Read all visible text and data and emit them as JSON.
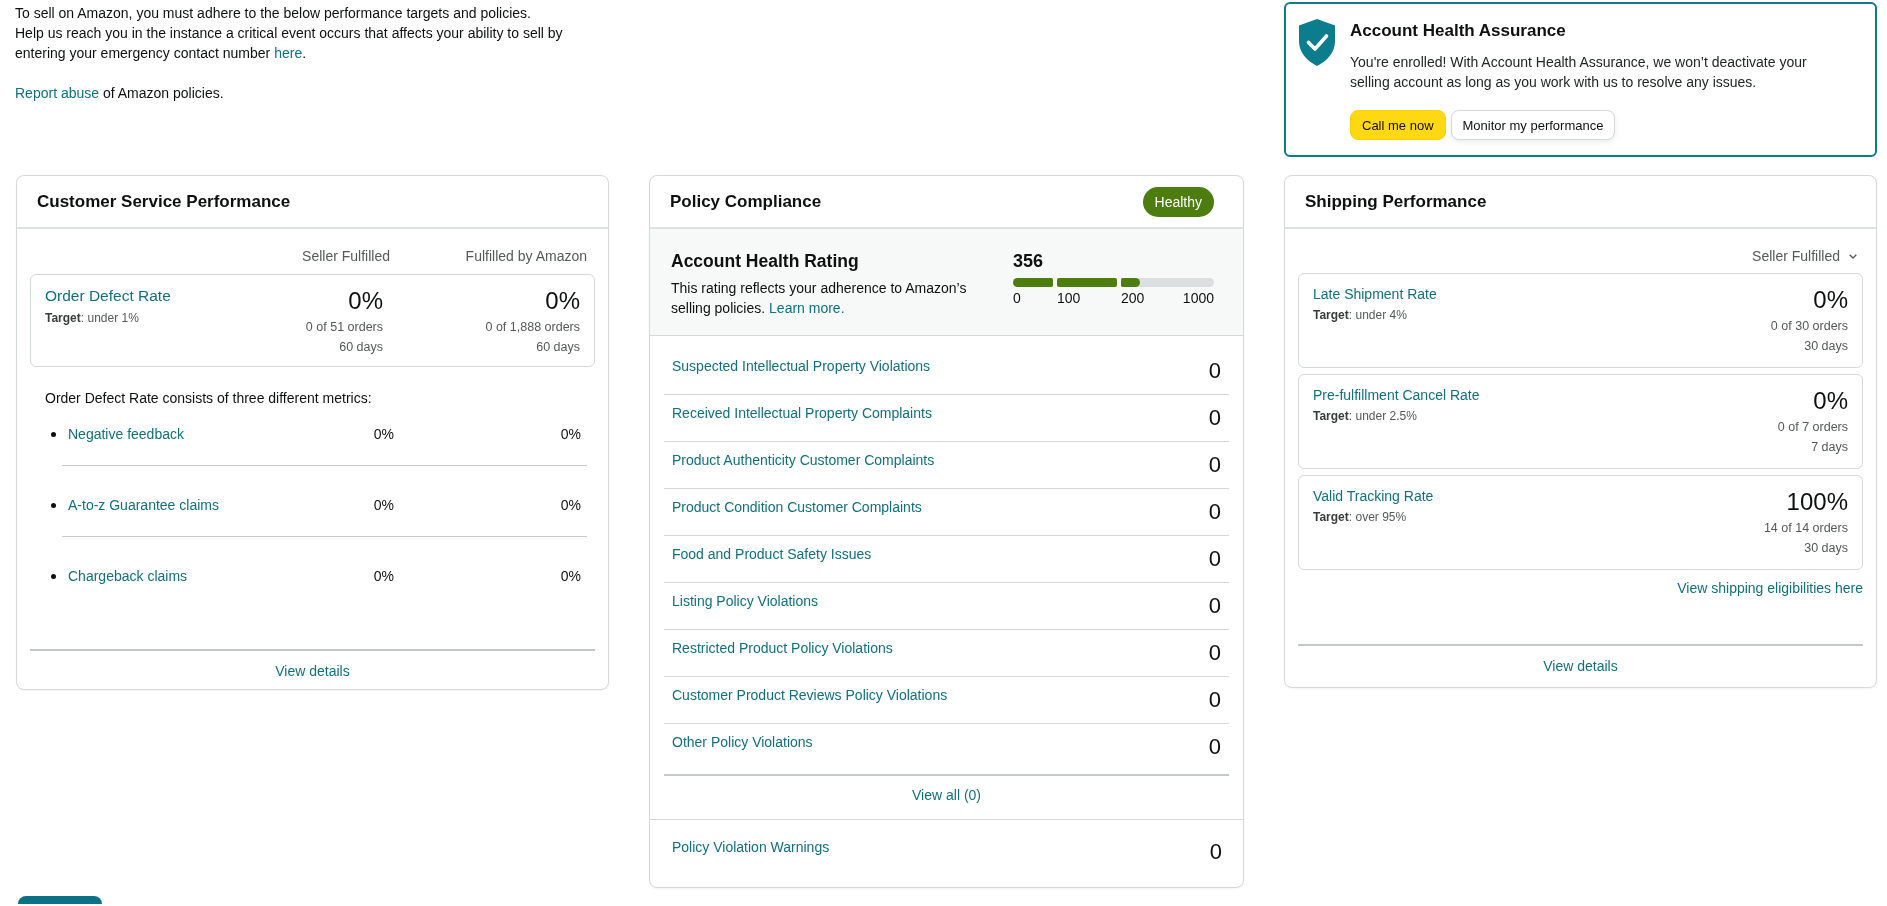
{
  "intro": {
    "notice": "To sell on Amazon, you must adhere to the below performance targets and policies.",
    "contact": {
      "text": "Help us reach you in the instance a critical event occurs that affects your ability to sell by entering your emergency contact number",
      "link": "here",
      "end": "."
    },
    "report": {
      "link": "Report abuse",
      "text": "of Amazon policies."
    }
  },
  "assurance": {
    "title": "Account Health Assurance",
    "message": "You're enrolled! With Account Health Assurance, we won’t deactivate your selling account as long as you work with us to resolve any issues.",
    "buttons": [
      {
        "label": "Call me now",
        "kind": "primary"
      },
      {
        "label": "Monitor my performance",
        "kind": "secondary"
      }
    ]
  },
  "customer_service": {
    "title": "Customer Service Performance",
    "columns": [
      "Seller Fulfilled",
      "Fulfilled by Amazon"
    ],
    "order_defect_rate": {
      "name": "Order Defect Rate",
      "target": "**Target**: under 1%",
      "values": [
        {
          "rate": "0%",
          "orders": "0 of 51 orders",
          "period": "60 days"
        },
        {
          "rate": "0%",
          "orders": "0 of 1,888 orders",
          "period": "60 days"
        }
      ]
    },
    "metrics_intro": "Order Defect Rate consists of three different metrics:",
    "metrics": [
      {
        "name": "Negative feedback",
        "values": [
          "0%",
          "0%"
        ]
      },
      {
        "name": "A-to-z Guarantee claims",
        "values": [
          "0%",
          "0%"
        ]
      },
      {
        "name": "Chargeback claims",
        "values": [
          "0%",
          "0%"
        ]
      }
    ],
    "footer_link": "View details"
  },
  "policy": {
    "title": "Policy Compliance",
    "status": {
      "label": "Healthy",
      "kind": "healthy"
    },
    "rating": {
      "title": "Account Health Rating",
      "description": "This rating reflects your adherence to Amazon’s selling policies.",
      "link": "Learn more.",
      "score": "356",
      "segments": [
        {
          "level": 1
        },
        {
          "level": 1
        },
        {
          "level": 0.2
        }
      ],
      "ticks": [
        "0",
        "100",
        "200",
        "1000"
      ]
    },
    "violations": [
      {
        "name": "Suspected Intellectual Property Violations",
        "count": "0"
      },
      {
        "name": "Received Intellectual Property Complaints",
        "count": "0"
      },
      {
        "name": "Product Authenticity Customer Complaints",
        "count": "0"
      },
      {
        "name": "Product Condition Customer Complaints",
        "count": "0"
      },
      {
        "name": "Food and Product Safety Issues",
        "count": "0"
      },
      {
        "name": "Listing Policy Violations",
        "count": "0"
      },
      {
        "name": "Restricted Product Policy Violations",
        "count": "0"
      },
      {
        "name": "Customer Product Reviews Policy Violations",
        "count": "0"
      },
      {
        "name": "Other Policy Violations",
        "count": "0"
      }
    ],
    "view_all": "View all (0)",
    "warnings": {
      "name": "Policy Violation Warnings",
      "count": "0"
    }
  },
  "shipping": {
    "title": "Shipping Performance",
    "filter": "Seller Fulfilled",
    "metrics": [
      {
        "name": "Late Shipment Rate",
        "target": "**Target**: under 4%",
        "rate": "0%",
        "orders": "0 of 30 orders",
        "period": "30 days"
      },
      {
        "name": "Pre-fulfillment Cancel Rate",
        "target": "**Target**: under 2.5%",
        "rate": "0%",
        "orders": "0 of 7 orders",
        "period": "7 days"
      },
      {
        "name": "Valid Tracking Rate",
        "target": "**Target**: over 95%",
        "rate": "100%",
        "orders": "14 of 14 orders",
        "period": "30 days"
      }
    ],
    "eligibility_link": "View shipping eligibilities here",
    "footer_link": "View details"
  }
}
